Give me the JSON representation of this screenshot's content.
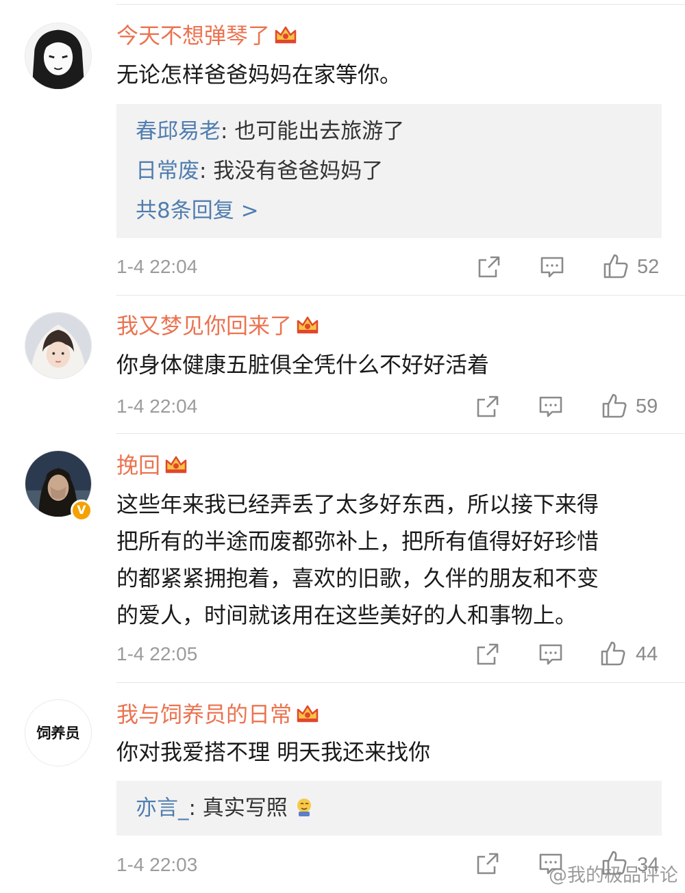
{
  "comments": [
    {
      "user": "今天不想弹琴了",
      "text": "无论怎样爸爸妈妈在家等你。",
      "replies": [
        {
          "name": "春邱易老",
          "text": ": 也可能出去旅游了"
        },
        {
          "name": "日常废",
          "text": ": 我没有爸爸妈妈了"
        }
      ],
      "more": "共8条回复 >",
      "time": "1-4 22:04",
      "likes": "52"
    },
    {
      "user": "我又梦见你回来了",
      "text": "你身体健康五脏俱全凭什么不好好活着",
      "time": "1-4 22:04",
      "likes": "59"
    },
    {
      "user": "挽回",
      "text": "这些年来我已经弄丢了太多好东西，所以接下来得\n把所有的半途而废都弥补上，把所有值得好好珍惜\n的都紧紧拥抱着，喜欢的旧歌，久伴的朋友和不变\n的爱人，时间就该用在这些美好的人和事物上。",
      "badge": "V",
      "time": "1-4 22:05",
      "likes": "44"
    },
    {
      "user": "我与饲养员的日常",
      "avatar_text": "饲养员",
      "text": "你对我爱搭不理 明天我还来找你",
      "replies": [
        {
          "name": "亦言_",
          "text": ": 真实写照"
        }
      ],
      "time": "1-4 22:03",
      "likes": "34"
    }
  ],
  "watermark": "@我的极品评论",
  "colors": {
    "username": "#eb7350",
    "reply_name": "#507daf",
    "reply_bg": "#f2f2f2",
    "meta": "#9b9b9b",
    "badge": "#f5a100"
  },
  "icons": [
    "crown-icon",
    "share-icon",
    "comment-icon",
    "like-icon",
    "verified-badge-icon",
    "emoji-icon"
  ]
}
